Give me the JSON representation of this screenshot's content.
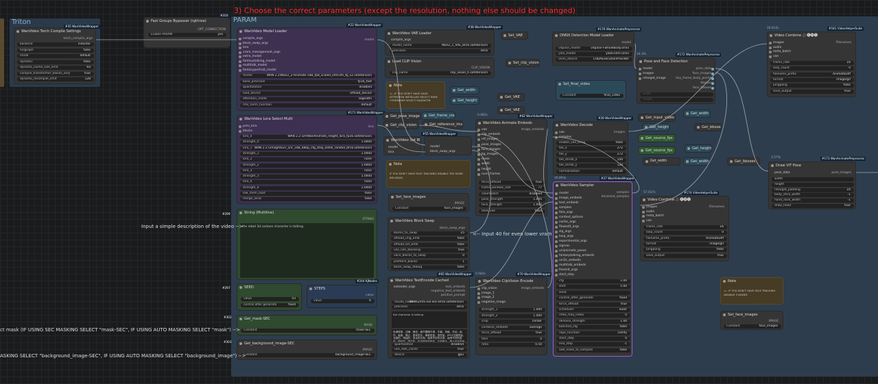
{
  "header_instruction": "3) Choose the correct parameters (except the resolution, nothing else should be changed)",
  "groups": {
    "triton": "Triton",
    "param": "PARAM"
  },
  "annotations": {
    "prompt_hint": "Input a simple description of the video -->",
    "blockswap_hint": "<-- Input 40 for even lower vram",
    "mask_hint": "ct mask (IF USING SEC MASKING SELECT \"mask-SEC\", IF USING AUTO MASKING SELECT \"mask\") -->",
    "bg_hint": "ASKING SELECT \"background_image-SEC\", IF USING AUTO MASKING SELECT \"background_image\") -->"
  },
  "torch_compile": {
    "title": "WanVideo Torch Compile Settings",
    "badge": "#35 WanVideoWrapper",
    "out": "torch_compile_args",
    "widgets": [
      [
        "backend",
        "inductor"
      ],
      [
        "fullgraph",
        "false"
      ],
      [
        "mode",
        "default"
      ],
      [
        "dynamic",
        "false"
      ],
      [
        "dynamo_cache_size_limit",
        "64"
      ],
      [
        "compile_transformer_blocks_only",
        "true"
      ],
      [
        "dynamo_recompile_limit",
        "128"
      ]
    ]
  },
  "bypasser": {
    "title": "Fast Groups Bypasser (rgthree)",
    "badge": "#310",
    "out": "OPT_CONNECTION",
    "widget": [
      "Enable PARAM",
      "yes"
    ]
  },
  "model_loader": {
    "title": "WanVideo Model Loader",
    "badge": "#22 WanVideoWrapper",
    "out": "model",
    "inputs": [
      "compile_args",
      "block_swap_args",
      "lora",
      "vram_management_args",
      "extra_model",
      "fantasytalking_model",
      "multitalk_model",
      "fantasyportrait_model"
    ],
    "widgets": [
      [
        "model",
        "WAN 2.2\\Wan2_2-Animate-14B_fp8_scaled_e4m3fn_KJ_v2.safetensors"
      ],
      [
        "base_precision",
        "fp16_fast"
      ],
      [
        "quantization",
        "disabled"
      ],
      [
        "load_device",
        "offload_device"
      ],
      [
        "attention_mode",
        "sageattn"
      ],
      [
        "rms_norm_function",
        "default"
      ]
    ]
  },
  "lora_select": {
    "title": "WanVideo Lora Select Multi",
    "badge": "#171 WanVideoWrapper",
    "out": "lora",
    "inputs": [
      "prev_lora",
      "blocks"
    ],
    "widgets": [
      [
        "lora_0",
        "WAN 2.2 I2V\\WanAnimate_relight_lora_fp16.safetensors"
      ],
      [
        "strength_0",
        "1.0000"
      ],
      [
        "lora_1",
        "WAN 2.2 I2V\\lightx2v_I2V_14B_480p_cfg_step_distill_rank64_bf16.safetensors"
      ],
      [
        "strength_1",
        "1.0000"
      ],
      [
        "lora_2",
        "none"
      ],
      [
        "strength_2",
        "1.0000"
      ],
      [
        "lora_3",
        "none"
      ],
      [
        "strength_3",
        "1.0000"
      ],
      [
        "lora_4",
        "none"
      ],
      [
        "strength_4",
        "1.0000"
      ],
      [
        "low_mem_load",
        "false"
      ],
      [
        "merge_loras",
        "false"
      ]
    ]
  },
  "string_multiline": {
    "title": "String (Multiline)",
    "badge": "#299",
    "out": "STRING",
    "text": "the robot 3d cartoon character is talking"
  },
  "vae_loader": {
    "title": "WanVideo VAE Loader",
    "badge": "#38 WanVideoWrapper",
    "input": "compile_args",
    "widgets": [
      [
        "model_name",
        "Wan2_1_VAE_bf16.safetensors"
      ],
      [
        "precision",
        "bf16"
      ]
    ]
  },
  "set_vae": "Set_VAE",
  "clip_vision": {
    "title": "Load CLIP Vision",
    "out": "CLIP_VISION",
    "widget": [
      "clip_name",
      "clip_vision_h.safetensors"
    ]
  },
  "set_clip_vision": "Set_clip_vision",
  "note1": {
    "title": "Note",
    "text": "<-- IF YOU DON'T HAVE SAGE ATTENTION INSTALLED SELECT SDPA OTHERWISE SELECT SAGEATTN"
  },
  "getters": [
    "Get_width",
    "Get_height",
    "Get_VAE",
    "Get_VAE",
    "Get_frame_count",
    "Get_pose_images",
    "Get_clip_vision",
    "Get_reference_image",
    "Get_face_images",
    "Get_width",
    "Get_height",
    "Get_bboxes",
    "Get_height",
    "Get_width",
    "Get_bboxes",
    "Get_source_fps",
    "Get_source_fps",
    "Get_input_video",
    "Get_height",
    "Get_width"
  ],
  "set_block": {
    "title": "WanVideo Set Bl...",
    "badge": "#55 WanVideoWrapper",
    "inputs": [
      "model",
      "lora"
    ],
    "outs": [
      "model",
      "block_swap_args"
    ]
  },
  "anim_embeds": {
    "title": "WanVideo Animate Embeds",
    "badge": "#62 WanVideoWrapper",
    "out": "image_embeds",
    "inputs": [
      "vae",
      "clip_embeds",
      "ref_images",
      "pose_images",
      "face_images",
      "bg_images",
      "mask",
      "width",
      "height",
      "num_frames"
    ],
    "widgets": [
      [
        "force_offload",
        "true"
      ],
      [
        "frame_window_size",
        "77"
      ],
      [
        "colormatch",
        "disabled"
      ],
      [
        "pose_strength",
        "1.000"
      ],
      [
        "face_strength",
        "1.000"
      ],
      [
        "tiled_vae",
        "false"
      ]
    ]
  },
  "note2": {
    "title": "Note",
    "text": "IF YOU DON'T HAVE FACE TRACKING DISABLE THE NODE BELOW(6)"
  },
  "set_face": {
    "title": "Set_face_images",
    "out": "IMAGE",
    "widget": [
      "Constant",
      "face_images"
    ]
  },
  "block_swap": {
    "title": "WanVideo Block Swap",
    "out": "block_swap_args",
    "widgets": [
      [
        "blocks_to_swap",
        "25"
      ],
      [
        "offload_img_emb",
        "false"
      ],
      [
        "offload_txt_emb",
        "false"
      ],
      [
        "use_non_blocking",
        "true"
      ],
      [
        "vace_blocks_to_swap",
        "0"
      ],
      [
        "prefetch_blocks",
        "1"
      ],
      [
        "block_swap_debug",
        "false"
      ]
    ]
  },
  "text_encode": {
    "title": "WanVideo TextEncode Cached",
    "badge": "#65 WanVideoWrapper",
    "outs": [
      "text_embeds",
      "negative_text_embeds",
      "positive_prompt"
    ],
    "input": "extender_args",
    "widgets": [
      [
        "model_name",
        "WAN\\umt5-xxl-enc-bf16.safetensors"
      ],
      [
        "precision",
        "bf16"
      ]
    ],
    "pos": "the character is talking",
    "neg": "色调艳丽，过曝，静态，细节模糊不清，字幕，风格，作品，画作，画面，静止，整体发灰，最差质量，低质量，JPEG压缩残留，丑陋的，残缺的，多余的手指，画得不好的手部，画得不好的脸部，畸形的，毁容的，形态畸形的肢体，手指融合，静止不动的画面，杂乱的背景，三条腿，背景人很多，倒着走",
    "widgets2": [
      [
        "quantization",
        "disabled"
      ],
      [
        "use_disk_cache",
        "true"
      ],
      [
        "device",
        "gpu"
      ]
    ]
  },
  "clip_vision_encode": {
    "title": "WanVideo ClipVision Encode",
    "badge": "#70 WanVideoWrapper",
    "out": "image_embeds",
    "inputs": [
      "clip_vision",
      "image_1",
      "image_2",
      "negative_image"
    ],
    "widgets": [
      [
        "strength_1",
        "1.000"
      ],
      [
        "strength_2",
        "1.000"
      ],
      [
        "crop",
        "center"
      ],
      [
        "combine_embeds",
        "average"
      ],
      [
        "force_offload",
        "true"
      ],
      [
        "tiles",
        "0"
      ],
      [
        "ratio",
        "0.50"
      ]
    ]
  },
  "decode": {
    "title": "WanVideo Decode",
    "badge": "#28 WanVideoWrapper",
    "out": "images",
    "inputs": [
      "vae",
      "samples"
    ],
    "widgets": [
      [
        "enable_vae_tiling",
        "false"
      ],
      [
        "tile_x",
        "272"
      ],
      [
        "tile_y",
        "272"
      ],
      [
        "tile_stride_x",
        "144"
      ],
      [
        "tile_stride_y",
        "128"
      ],
      [
        "normalization",
        "default"
      ]
    ]
  },
  "sampler": {
    "title": "WanVideo Sampler",
    "badge": "#27 WanVideoWrapper",
    "outs": [
      "samples",
      "denoised_samples"
    ],
    "inputs": [
      "model",
      "image_embeds",
      "text_embeds",
      "samples",
      "feta_args",
      "context_options",
      "cache_args",
      "flowedit_args",
      "slg_args",
      "loop_args",
      "experimental_args",
      "sigmas",
      "unianimate_poses",
      "fantasytalking_embeds",
      "uni3c_embeds",
      "multitalk_embeds",
      "freeinit_args",
      "start_step"
    ],
    "widgets": [
      [
        "cfg",
        "1.00"
      ],
      [
        "shift",
        "5.00"
      ],
      [
        "seed",
        ""
      ],
      [
        "control_after_generate",
        "fixed"
      ],
      [
        "force_offload",
        "true"
      ],
      [
        "scheduler",
        "euler"
      ],
      [
        "riflex_freq_index",
        "0"
      ],
      [
        "denoise_strength",
        "1.00"
      ],
      [
        "batched_cfg",
        "false"
      ],
      [
        "rope_function",
        "comfy"
      ],
      [
        "start_step",
        "0"
      ],
      [
        "end_step",
        "-1"
      ],
      [
        "add_noise_to_samples",
        "false"
      ]
    ]
  },
  "onnx": {
    "title": "ONNX Detection Model Loader",
    "badge": "#176 WanAnimatePreprocess",
    "out": "model",
    "widgets": [
      [
        "vitpose_model",
        "vitpose-l-wholebody.onnx"
      ],
      [
        "yolo_model",
        "yolov10m.onnx"
      ],
      [
        "onnx_device",
        "CUDAExecutionProvider"
      ]
    ]
  },
  "set_final": {
    "title": "Set_final_video",
    "widget": [
      "Constant",
      "final_video"
    ]
  },
  "pose_face": {
    "title": "Pose and Face Detection",
    "badge": "#172 WanAnimatePreprocess",
    "inputs": [
      "model",
      "images",
      "retarget_image"
    ],
    "outs": [
      "pose_data",
      "face_images",
      "key_frame_body_points",
      "bboxes",
      "face_bboxes"
    ],
    "widgets": [
      [
        "width",
        ""
      ],
      [
        "height",
        ""
      ]
    ]
  },
  "combine1": {
    "title": "Video Combine 🎥🅥🅗🅢",
    "badge": "#181 VideoHelperSuite",
    "inputs": [
      "images",
      "audio",
      "meta_batch",
      "vae"
    ],
    "outs": [
      "Filenames"
    ],
    "widgets": [
      [
        "frame_rate",
        "16"
      ],
      [
        "loop_count",
        "0"
      ],
      [
        "filename_prefix",
        "AnimateDiff"
      ],
      [
        "format",
        "image/gif"
      ],
      [
        "pingpong",
        "false"
      ],
      [
        "save_output",
        "true"
      ]
    ]
  },
  "pose_draw": {
    "title": "Draw ViT Pose",
    "badge": "#173 WanAnimatePreprocess",
    "input": "pose_data",
    "out": "pose_images",
    "widgets": [
      [
        "width",
        ""
      ],
      [
        "height",
        ""
      ],
      [
        "retarget_padding",
        "16"
      ],
      [
        "body_stick_width",
        "-1"
      ],
      [
        "hand_stick_width",
        "-1"
      ],
      [
        "draw_head",
        "true"
      ]
    ]
  },
  "combine2": {
    "title": "Video Combine 🎥🅥🅗🅢",
    "badge": "#174 VideoHelperSuite",
    "inputs": [
      "images",
      "audio",
      "meta_batch",
      "vae"
    ],
    "outs": [
      "Filenames"
    ],
    "widgets": [
      [
        "frame_rate",
        "16"
      ],
      [
        "loop_count",
        "0"
      ],
      [
        "filename_prefix",
        "AnimateDiff"
      ],
      [
        "format",
        "image/gif"
      ],
      [
        "pingpong",
        "false"
      ],
      [
        "save_output",
        "true"
      ]
    ]
  },
  "note3": {
    "title": "Note",
    "text": "<-- IF YOU DON'T HAVE FACE TRACKING DISABLE 3 NODES"
  },
  "set_face2": {
    "title": "Set_face_images",
    "out": "IMAGE",
    "widget": [
      "Constant",
      "face_images"
    ]
  },
  "seed": {
    "title": "SEED",
    "badge": "#297",
    "widgets": [
      [
        "value",
        "43"
      ],
      [
        "control after generate",
        "fixed"
      ]
    ]
  },
  "steps": {
    "title": "STEPS",
    "badge": "#244 KJNodes",
    "out": "value",
    "widget": [
      "value",
      "6"
    ]
  },
  "get_mask": {
    "title": "Get_mask-SEC",
    "badge": "#302",
    "out": "MASK",
    "widget": [
      "Constant",
      "mask-SEC"
    ]
  },
  "get_bg": {
    "title": "Get_background_image-SEC",
    "badge": "#303",
    "out": "IMAGE",
    "widget": [
      "Constant",
      "background_image-SEC"
    ]
  },
  "pct": {
    "a": "0.083s",
    "b": "16.893s",
    "c": "57.037s",
    "d": "3.57%",
    "e": "20.815s",
    "f": "24.3%",
    "g": "0.583s"
  },
  "colors": {
    "param_group": "#2d3d4d",
    "model_loader": "#3d3050",
    "lora": "#3d3050",
    "string": "#2f4a2e",
    "seed_group": "#2f4a2e",
    "sampler_border": "#a855d8",
    "note": "#463b24"
  }
}
